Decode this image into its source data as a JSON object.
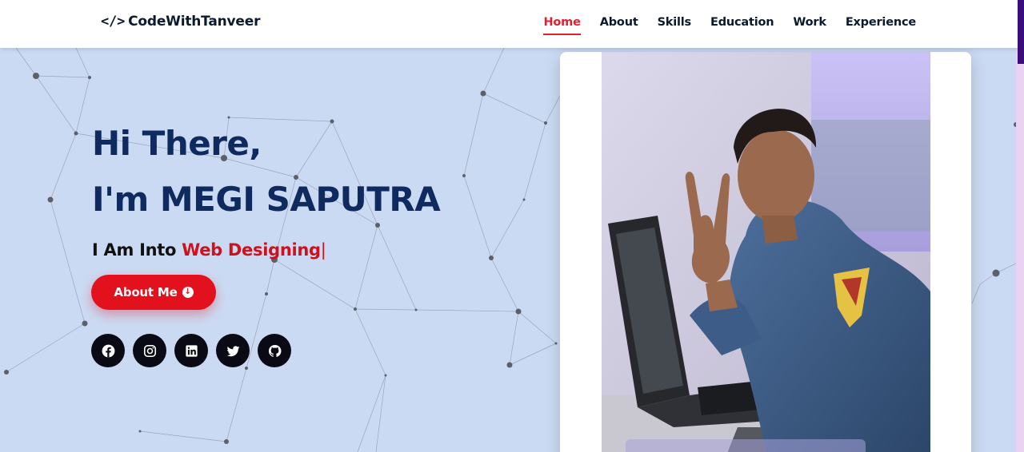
{
  "brand": {
    "icon": "code-icon",
    "icon_glyph": "</>",
    "name": "CodeWithTanveer"
  },
  "nav": {
    "items": [
      "Home",
      "About",
      "Skills",
      "Education",
      "Work",
      "Experience"
    ],
    "active": "Home"
  },
  "hero": {
    "greeting_line1": "Hi There,",
    "greeting_line2": "I'm MEGI SAPUTRA",
    "typed_prefix": "I Am Into",
    "typed_role": "Web Designing",
    "typed_cursor": "|",
    "button_label": "About Me",
    "button_icon": "arrow-down-circle-icon"
  },
  "socials": [
    "facebook-icon",
    "instagram-icon",
    "linkedin-icon",
    "twitter-icon",
    "github-icon"
  ],
  "photo": {
    "icon": "profile-photo"
  },
  "colors": {
    "accent": "#e3101e",
    "heading": "#0e2a5e",
    "background": "#cbdaf3",
    "dark": "#0a0a14"
  }
}
